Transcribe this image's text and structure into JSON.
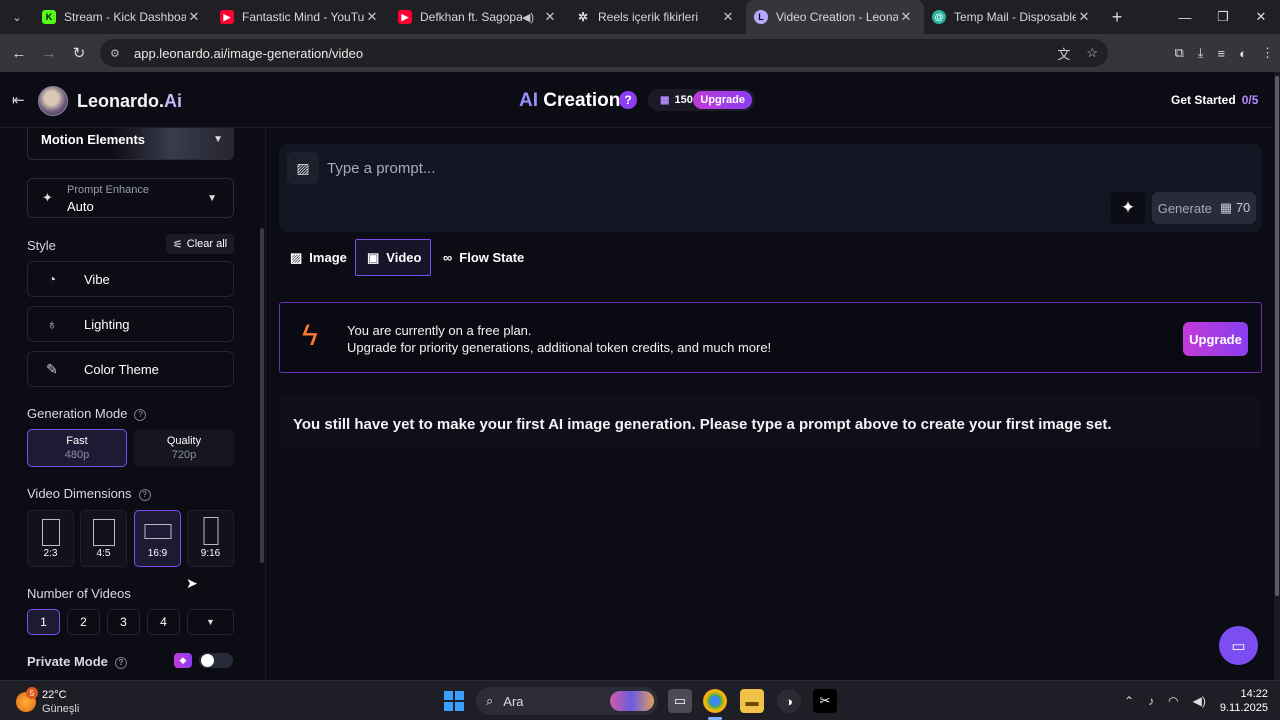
{
  "browser": {
    "tabs": [
      {
        "title": "Stream - Kick Dashboard",
        "icon": "kick-logo-icon",
        "color": "#53fc18",
        "glyph": "K"
      },
      {
        "title": "Fantastic Mind - YouTube",
        "icon": "youtube-icon",
        "color": "#ff0033",
        "glyph": "▶"
      },
      {
        "title": "Defkhan ft. Sagopa Ka",
        "icon": "youtube-icon",
        "color": "#ff0033",
        "glyph": "▶"
      },
      {
        "title": "Reels içerik fikirleri",
        "icon": "chatgpt-icon",
        "color": "#dddddd",
        "glyph": "✲"
      },
      {
        "title": "Video Creation - Leonardo",
        "icon": "leonardo-icon",
        "color": "#b9a6ff",
        "glyph": "L"
      },
      {
        "title": "Temp Mail - Disposable Te",
        "icon": "tempmail-icon",
        "color": "#2bb3a0",
        "glyph": "@"
      }
    ],
    "url": "app.leonardo.ai/image-generation/video"
  },
  "header": {
    "brand_prefix": "Leonardo.",
    "brand_suffix": "Ai",
    "title_prefix": "AI",
    "title_suffix": " Creation",
    "help": "?",
    "credits": "150",
    "upgrade": "Upgrade",
    "get_started": "Get Started",
    "get_started_count": "0/5"
  },
  "sidebar": {
    "motion_elements": "Motion Elements",
    "prompt_enhance_label": "Prompt Enhance",
    "prompt_enhance_value": "Auto",
    "style_title": "Style",
    "clear_all": "Clear all",
    "style_items": [
      "Vibe",
      "Lighting",
      "Color Theme"
    ],
    "generation_mode_title": "Generation Mode",
    "modes": [
      {
        "title": "Fast",
        "sub": "480p"
      },
      {
        "title": "Quality",
        "sub": "720p"
      }
    ],
    "video_dimensions_title": "Video Dimensions",
    "dimensions": [
      "2:3",
      "4:5",
      "16:9",
      "9:16"
    ],
    "number_title": "Number of Videos",
    "numbers": [
      "1",
      "2",
      "3",
      "4"
    ],
    "private_mode": "Private Mode"
  },
  "main": {
    "prompt_placeholder": "Type a prompt...",
    "generate": "Generate",
    "generate_cost": "70",
    "mode_tabs": [
      "Image",
      "Video",
      "Flow State"
    ],
    "banner_line1": "You are currently on a free plan.",
    "banner_line2": "Upgrade for priority generations, additional token credits, and much more!",
    "banner_upgrade": "Upgrade",
    "empty_message": "You still have yet to make your first AI image generation. Please type a prompt above to create your first image set."
  },
  "taskbar": {
    "weather_badge": "5",
    "temperature": "22°C",
    "weather_desc": "Güneşli",
    "search_label": "Ara",
    "time": "14:22",
    "date": "9.11.2025"
  },
  "colors": {
    "accent": "#7c4df0",
    "upgrade_gradient_start": "#c13bd8",
    "upgrade_gradient_end": "#8a3df0",
    "background": "#0b0c14"
  }
}
